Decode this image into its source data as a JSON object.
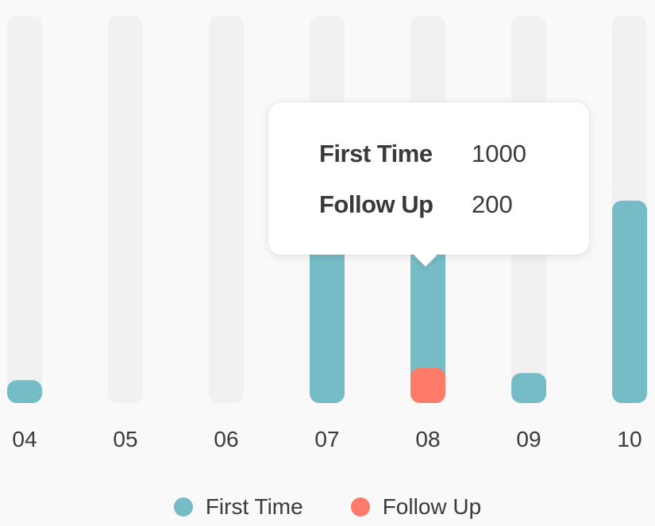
{
  "chart_data": {
    "type": "bar",
    "categories": [
      "04",
      "05",
      "06",
      "07",
      "08",
      "09",
      "10"
    ],
    "series": [
      {
        "name": "First Time",
        "color": "#76bcc6",
        "values": [
          130,
          0,
          0,
          1700,
          1000,
          170,
          1150
        ]
      },
      {
        "name": "Follow Up",
        "color": "#fe7b6a",
        "values": [
          0,
          0,
          0,
          0,
          200,
          0,
          0
        ]
      }
    ],
    "ylim": [
      0,
      2200
    ],
    "track_color": "#f1f1f1",
    "tooltip": {
      "category": "08",
      "rows": [
        {
          "label": "First Time",
          "value": "1000"
        },
        {
          "label": "Follow Up",
          "value": "200"
        }
      ]
    },
    "legend": [
      {
        "label": "First Time",
        "color": "#76bcc6"
      },
      {
        "label": "Follow Up",
        "color": "#fe7b6a"
      }
    ]
  }
}
